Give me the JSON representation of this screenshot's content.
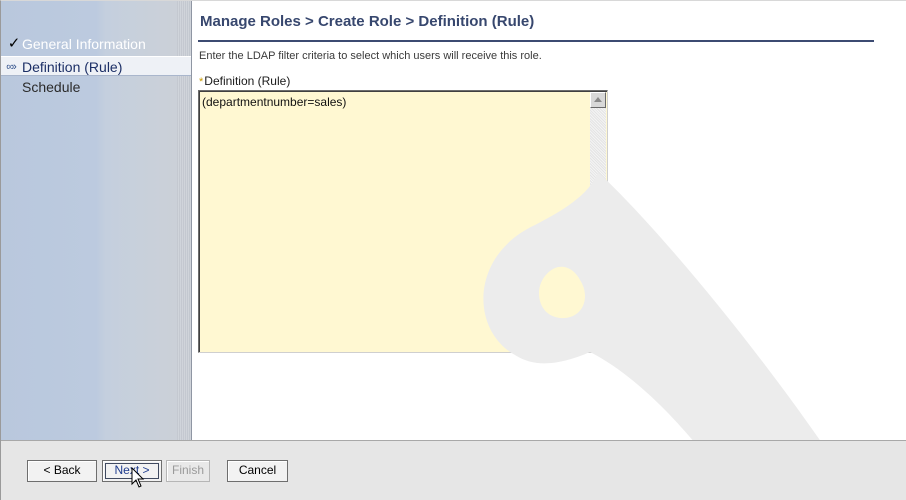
{
  "sidebar": {
    "items": [
      {
        "label": "General Information",
        "mark": "✓",
        "state": "completed"
      },
      {
        "label": "Definition (Rule)",
        "mark": "∞›",
        "state": "current"
      },
      {
        "label": "Schedule",
        "mark": "",
        "state": "pending"
      }
    ]
  },
  "main": {
    "title": "Manage Roles > Create Role > Definition (Rule)",
    "description": "Enter the LDAP filter criteria to select which users will receive this role.",
    "field": {
      "required_marker": "*",
      "label": "Definition (Rule)",
      "value": "(departmentnumber=sales)"
    }
  },
  "footer": {
    "back_label": "< Back",
    "next_label": "Next >",
    "finish_label": "Finish",
    "cancel_label": "Cancel"
  },
  "colors": {
    "title": "#37476e",
    "textarea_bg": "#fff8d2",
    "required": "#c99a00",
    "footer_bg": "#e6e6e6"
  },
  "icons": [
    "checkmark-icon",
    "current-step-icon",
    "scroll-up-arrow-icon",
    "scroll-down-arrow-icon",
    "mouse-pointer-icon"
  ]
}
